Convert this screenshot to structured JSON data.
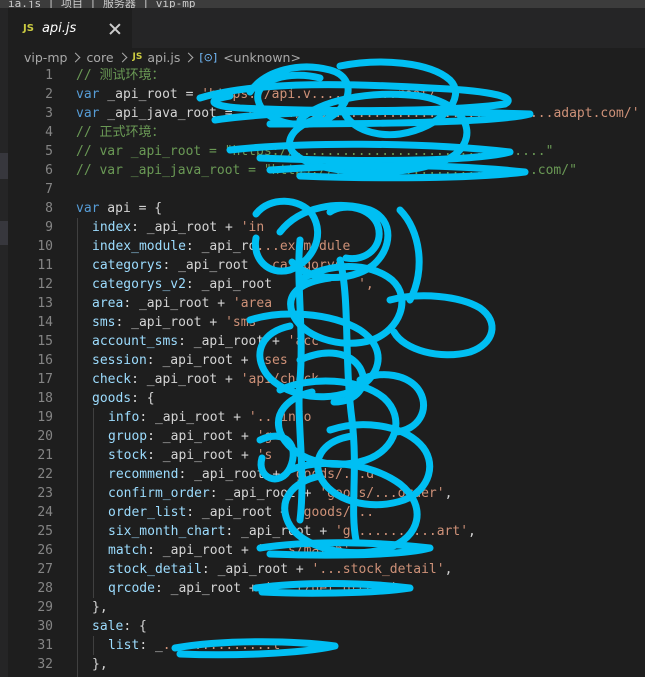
{
  "window": {
    "top_fragment": "ia.js | 项目 | 服务器 | vip-mp"
  },
  "tab": {
    "badge": "JS",
    "label": "api.js"
  },
  "breadcrumb": {
    "items": [
      "vip-mp",
      "core"
    ],
    "file_badge": "JS",
    "file": "api.js",
    "symbol_icon": "[⊙]",
    "symbol": "<unknown>"
  },
  "colors": {
    "scribble": "#00bff3",
    "comment": "#6a9955",
    "keyword": "#569cd6",
    "property": "#9cdcfe",
    "string": "#ce9178"
  },
  "code": {
    "line_numbers": [
      "1",
      "2",
      "3",
      "4",
      "5",
      "6",
      "7",
      "8",
      "9",
      "10",
      "11",
      "12",
      "13",
      "14",
      "15",
      "16",
      "17",
      "18",
      "19",
      "20",
      "21",
      "22",
      "23",
      "24",
      "25",
      "26",
      "27",
      "28",
      "29",
      "30",
      "31",
      "32"
    ],
    "l1": "// 测试环境：",
    "l2_kw": "var",
    "l2_rest": " _api_root = ",
    "l2_str": "'https://api.v...........root/'",
    "l3_kw": "var",
    "l3_rest": " _api_java_root = ",
    "l3_str": "'https://api............................adapt.com/'",
    "l4": "// 正式环境：",
    "l5": "// var _api_root = \"https://................................\"",
    "l6": "// var _api_java_root = \"https://..........................com/\"",
    "l8_kw": "var",
    "l8_rest": " api = {",
    "l9_key": "index",
    "l9_rest": ": _api_root + ",
    "l9_str": "'in",
    "l10_key": "index_module",
    "l10_rest": ": _api_ro",
    "l10_str": "...ex/module",
    "l11_key": "categorys",
    "l11_rest": ": _api_root ",
    "l11_str": "  categorys",
    "l12_key": "categorys_v2",
    "l12_rest": ": _api_root ",
    "l12_str": "          ',",
    "l13_key": "area",
    "l13_rest": ": _api_root + ",
    "l13_str": "'area",
    "l14_key": "sms",
    "l14_rest": ": _api_root + ",
    "l14_str": "'sms'",
    "l15_key": "account_sms",
    "l15_rest": ": _api_root + ",
    "l15_str": "'acc",
    "l16_key": "session",
    "l16_rest": ": _api_root + ",
    "l16_str": "'ses",
    "l17_key": "check",
    "l17_rest": ": _api_root + ",
    "l17_str": "'api/check",
    "l18_key": "goods",
    "l18_rest": ": {",
    "l19_key": "info",
    "l19_rest": ": _api_root + ",
    "l19_str": "'...info",
    "l20_key": "gruop",
    "l20_rest": ": _api_root + ",
    "l20_str": "'g",
    "l21_key": "stock",
    "l21_rest": ": _api_root + ",
    "l21_str": "'s",
    "l22_key": "recommend",
    "l22_rest": ": _api_root + ",
    "l22_str": "'goods/...d",
    "l23_key": "confirm_order",
    "l23_rest": ": _api_root + ",
    "l23_str": "'goods/...order'",
    "l23_tail": ",",
    "l24_key": "order_list",
    "l24_rest": ": _api_root + ",
    "l24_str": "'goods/...",
    "l25_key": "six_month_chart",
    "l25_rest": ": _api_root + ",
    "l25_str": "'g...........art'",
    "l25_tail": ",",
    "l26_key": "match",
    "l26_rest": ": _api_root + ",
    "l26_str": "'...s/match'",
    "l27_key": "stock_detail",
    "l27_rest": ": _api_root + ",
    "l27_str": "'...stock_detail'",
    "l27_tail": ",",
    "l28_key": "qrcode",
    "l28_rest": ": _api_root + ",
    "l28_str": "'...l/get_qrcode'",
    "l29": "},",
    "l30_key": "sale",
    "l30_rest": ": {",
    "l31_key": "list",
    "l31_rest": ": _",
    "l31_str": "..............t'",
    "l32": "},"
  }
}
